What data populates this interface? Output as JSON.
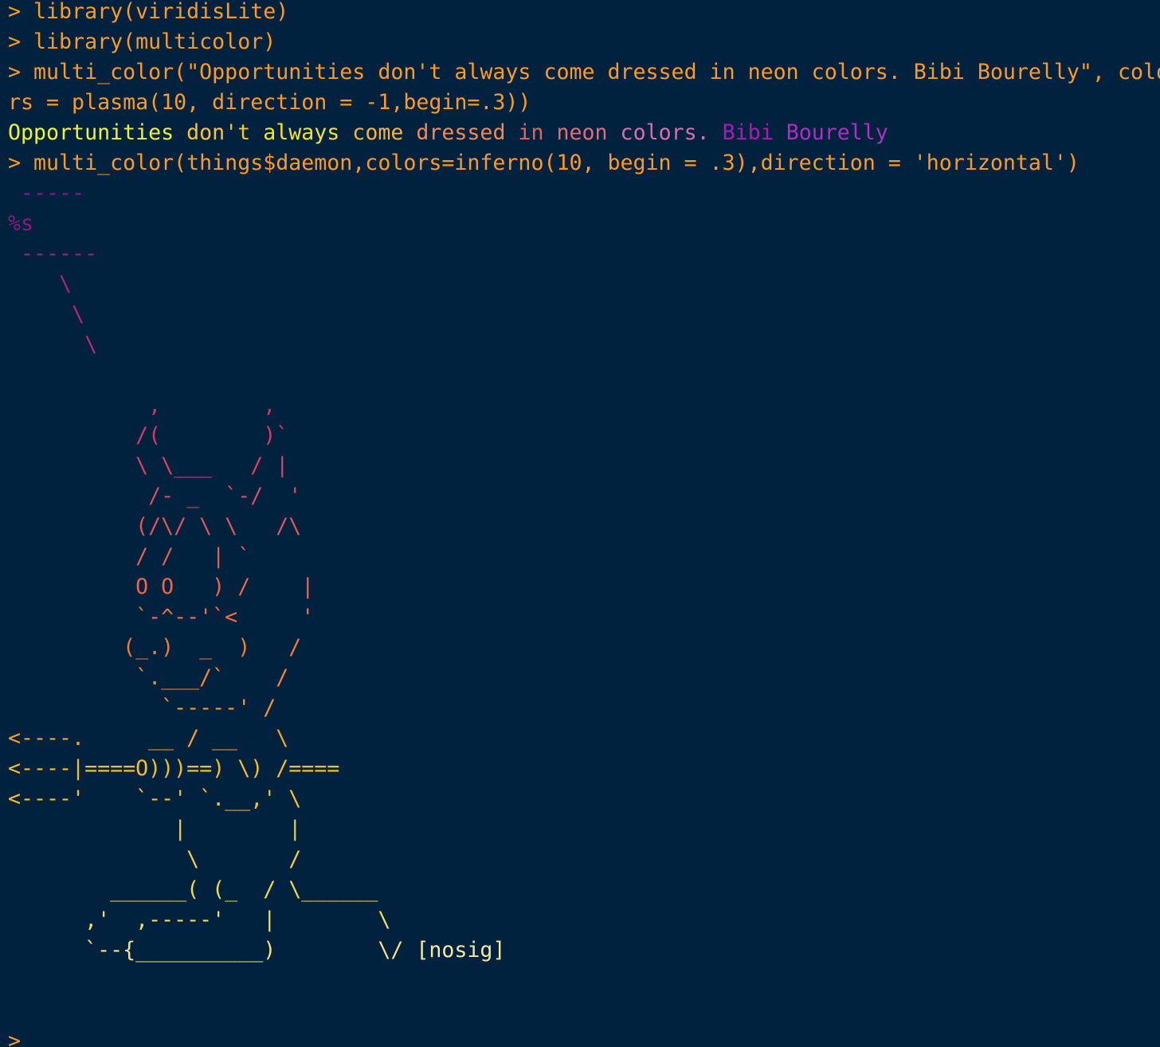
{
  "colors": {
    "background": "#01223f",
    "command": "#ff9a1f"
  },
  "console": {
    "lines": [
      {
        "segs": [
          {
            "t": "> library(viridisLite)",
            "c": "#ff9a1f"
          }
        ]
      },
      {
        "segs": [
          {
            "t": "> library(multicolor)",
            "c": "#ff9a1f"
          }
        ]
      },
      {
        "segs": [
          {
            "t": "> multi_color(\"Opportunities don't always come dressed in neon colors. Bibi Bourelly\", colo",
            "c": "#ff9a1f"
          }
        ]
      },
      {
        "segs": [
          {
            "t": "rs = plasma(10, direction = -1,begin=.3))",
            "c": "#ff9a1f"
          }
        ]
      },
      {
        "segs": [
          {
            "t": "Opportunities",
            "c": "#f1f523"
          },
          {
            "t": " don't ",
            "c": "#fdc42e"
          },
          {
            "t": "always",
            "c": "#f7e22a"
          },
          {
            "t": " come ",
            "c": "#fbb236"
          },
          {
            "t": "dressed",
            "c": "#f48a4f"
          },
          {
            "t": " in ",
            "c": "#e16462"
          },
          {
            "t": "neon",
            "c": "#e26a79"
          },
          {
            "t": " colors. ",
            "c": "#da6cb0"
          },
          {
            "t": "Bibi ",
            "c": "#ae1ab0"
          },
          {
            "t": "Bourelly",
            "c": "#b22cc4"
          }
        ]
      },
      {
        "segs": [
          {
            "t": "> multi_color(things$daemon,colors=inferno(10, begin = .3),direction = 'horizontal')",
            "c": "#ff9a1f"
          }
        ]
      },
      {
        "segs": [
          {
            "t": " -----",
            "c": "#8a1a7e"
          }
        ]
      },
      {
        "segs": [
          {
            "t": "%s",
            "c": "#8a1a7e"
          }
        ]
      },
      {
        "segs": [
          {
            "t": " ------",
            "c": "#9a1f7e"
          }
        ]
      },
      {
        "segs": [
          {
            "t": "    \\",
            "c": "#a8237c"
          }
        ]
      },
      {
        "segs": [
          {
            "t": "     \\",
            "c": "#b22778"
          }
        ]
      },
      {
        "segs": [
          {
            "t": "      \\",
            "c": "#bc2b72"
          }
        ]
      },
      {
        "segs": [
          {
            "t": "",
            "c": "#c6306c"
          }
        ]
      },
      {
        "segs": [
          {
            "t": "           ,        ,",
            "c": "#ca3468"
          }
        ]
      },
      {
        "segs": [
          {
            "t": "          /(        )`",
            "c": "#d33b62"
          }
        ]
      },
      {
        "segs": [
          {
            "t": "          \\ \\___   / |",
            "c": "#db415e"
          }
        ]
      },
      {
        "segs": [
          {
            "t": "           /- _  `-/  '",
            "c": "#e04b59"
          }
        ]
      },
      {
        "segs": [
          {
            "t": "          (/\\/ \\ \\   /\\",
            "c": "#e55454"
          }
        ]
      },
      {
        "segs": [
          {
            "t": "          / /   | `",
            "c": "#ea5d4e"
          }
        ]
      },
      {
        "segs": [
          {
            "t": "          O O   ) /    |",
            "c": "#ee6547"
          }
        ]
      },
      {
        "segs": [
          {
            "t": "          `-^--'`<     '",
            "c": "#f16f3f"
          }
        ]
      },
      {
        "segs": [
          {
            "t": "         (_.)  _  )   /",
            "c": "#f47b35"
          }
        ]
      },
      {
        "segs": [
          {
            "t": "          `.___/`    /",
            "c": "#f6882c"
          }
        ]
      },
      {
        "segs": [
          {
            "t": "            `-----' /",
            "c": "#f89524"
          }
        ]
      },
      {
        "segs": [
          {
            "t": "<----.     __ / __   \\",
            "c": "#f9a21d"
          }
        ]
      },
      {
        "segs": [
          {
            "t": "<----|====O)))==) \\) /====",
            "c": "#f8bd1f"
          }
        ]
      },
      {
        "segs": [
          {
            "t": "<----'    `--' `.__,' \\",
            "c": "#f7c125"
          }
        ]
      },
      {
        "segs": [
          {
            "t": "             |        |",
            "c": "#f5ca31"
          }
        ]
      },
      {
        "segs": [
          {
            "t": "              \\       /",
            "c": "#f4d13c"
          }
        ]
      },
      {
        "segs": [
          {
            "t": "        ______( (_  / \\______",
            "c": "#f2d748"
          }
        ]
      },
      {
        "segs": [
          {
            "t": "      ,'  ,-----'   |        \\",
            "c": "#f3dd5a"
          }
        ]
      },
      {
        "segs": [
          {
            "t": "      `--{__________)        \\/ ",
            "c": "#f5e27a"
          },
          {
            "t": "[nosig]",
            "c": "#f6e99e"
          }
        ]
      },
      {
        "segs": [
          {
            "t": "",
            "c": "#ff9a1f"
          }
        ]
      },
      {
        "segs": [
          {
            "t": "",
            "c": "#ff9a1f"
          }
        ]
      },
      {
        "segs": [
          {
            "t": ">",
            "c": "#ff9a1f"
          }
        ]
      }
    ]
  }
}
